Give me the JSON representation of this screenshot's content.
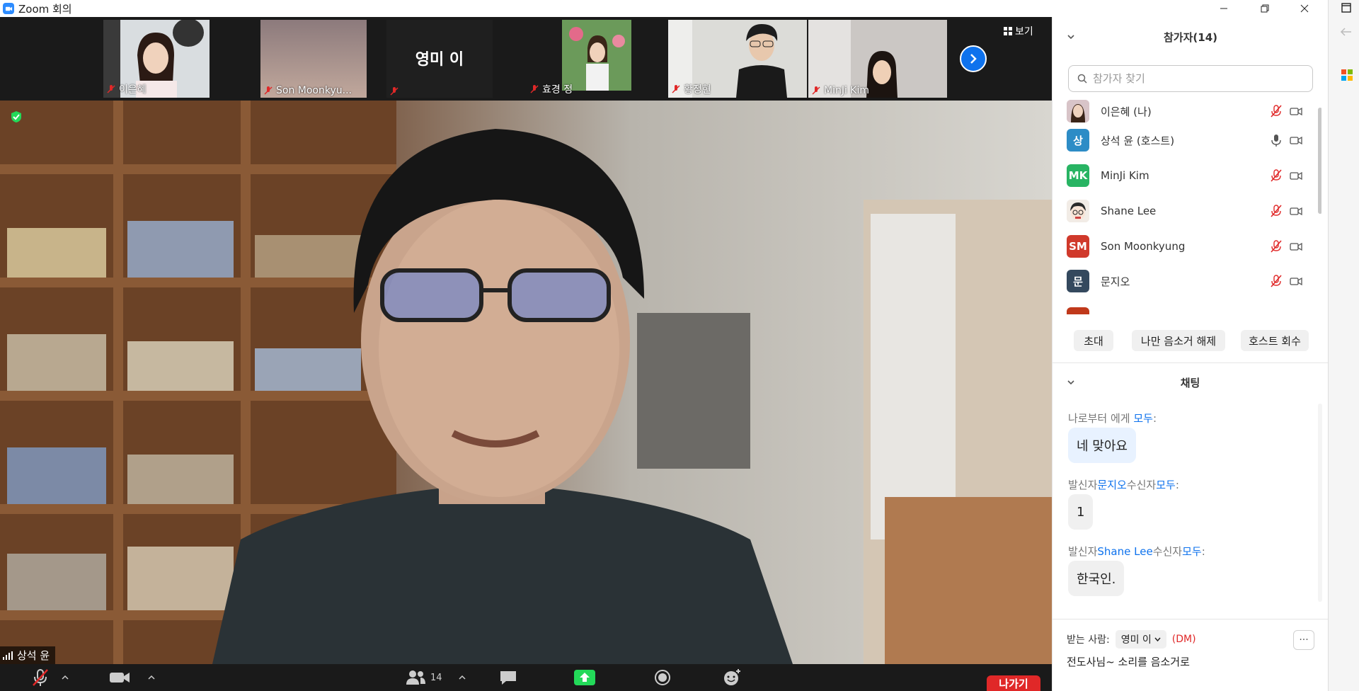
{
  "window": {
    "title": "Zoom 회의"
  },
  "thumbnails": [
    {
      "name": "이은혜",
      "type": "video",
      "tone": "#cfd5da"
    },
    {
      "name": "Son Moonkyu...",
      "type": "video",
      "tone": "#9e8a88"
    },
    {
      "name": "",
      "type": "name",
      "display_name": "영미 이"
    },
    {
      "name": "효경 정",
      "type": "video",
      "tone": "#7aa46a"
    },
    {
      "name": "황정현",
      "type": "video",
      "tone": "#d8d8d4"
    },
    {
      "name": "MinJi Kim",
      "type": "video",
      "tone": "#c9c4c0"
    }
  ],
  "view_button": {
    "label": "보기"
  },
  "main_video": {
    "speaker_name": "상석 윤"
  },
  "toolbar": {
    "participant_count": "14",
    "leave_label": "나가기"
  },
  "participants_panel": {
    "title": "참가자(14)",
    "search_placeholder": "참가자 찾기",
    "participants": [
      {
        "name": "이은혜 (나)",
        "avatar_text": "",
        "avatar_color": "#c9a9b5",
        "mic": "muted"
      },
      {
        "name": "상석 윤 (호스트)",
        "avatar_text": "상",
        "avatar_color": "#2d8cc6",
        "mic": "on"
      },
      {
        "name": "MinJi Kim",
        "avatar_text": "MK",
        "avatar_color": "#28b463",
        "mic": "muted"
      },
      {
        "name": "Shane Lee",
        "avatar_text": "",
        "avatar_color": "#e8e2dc",
        "mic": "muted"
      },
      {
        "name": "Son Moonkyung",
        "avatar_text": "SM",
        "avatar_color": "#d0392b",
        "mic": "muted"
      },
      {
        "name": "문지오",
        "avatar_text": "문",
        "avatar_color": "#34495e",
        "mic": "muted"
      }
    ],
    "buttons": {
      "invite": "초대",
      "unmute_me": "나만 음소거 해제",
      "reclaim_host": "호스트 회수"
    }
  },
  "chat_panel": {
    "title": "채팅",
    "messages": [
      {
        "prefix": "나로부터 에게 ",
        "sender": "",
        "mid": "",
        "recipient": "모두",
        "suffix": ":",
        "text": "네 맞아요",
        "style": "blue"
      },
      {
        "prefix": "발신자",
        "sender": "문지오",
        "mid": "수신자",
        "recipient": "모두",
        "suffix": ":",
        "text": "1",
        "style": "grey"
      },
      {
        "prefix": "발신자",
        "sender": "Shane Lee",
        "mid": "수신자",
        "recipient": "모두",
        "suffix": ":",
        "text": "한국인.",
        "style": "grey"
      }
    ],
    "recipient_label": "받는 사람:",
    "recipient_value": "영미 이",
    "dm_tag": "(DM)",
    "more_label": "···",
    "input_text": "전도사님~ 소리를 음소거로"
  }
}
